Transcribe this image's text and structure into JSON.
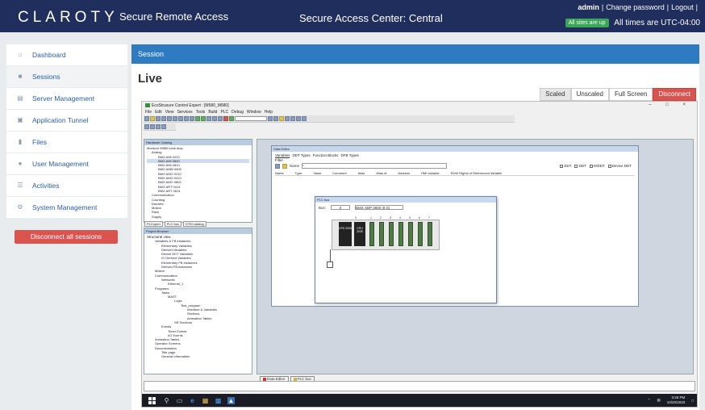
{
  "header": {
    "brand": "CLAROTY",
    "product": "Secure Remote Access",
    "center_name": "Secure Access Center: Central",
    "user": "admin",
    "change_password": "Change password",
    "logout": "Logout",
    "sites_badge": "All sites are up",
    "timezone": "All times are UTC-04:00"
  },
  "sidebar": {
    "items": [
      {
        "label": "Dashboard",
        "icon": "home-icon"
      },
      {
        "label": "Sessions",
        "icon": "video-icon"
      },
      {
        "label": "Server Management",
        "icon": "server-icon"
      },
      {
        "label": "Application Tunnel",
        "icon": "tunnel-icon"
      },
      {
        "label": "Files",
        "icon": "file-icon"
      },
      {
        "label": "User Management",
        "icon": "user-icon"
      },
      {
        "label": "Activities",
        "icon": "list-icon"
      },
      {
        "label": "System Management",
        "icon": "gear-icon"
      }
    ],
    "active_index": 1,
    "disconnect_all": "Disconnect all sessions"
  },
  "main": {
    "section_header": "Session",
    "page_title": "Live",
    "view_buttons": {
      "scaled": "Scaled",
      "unscaled": "Unscaled",
      "full_screen": "Full Screen",
      "disconnect": "Disconnect"
    }
  },
  "remote": {
    "app_title": "EcoStruxure Control Expert : [M580_M580]",
    "menu": [
      "File",
      "Edit",
      "View",
      "Services",
      "Tools",
      "Build",
      "PLC",
      "Debug",
      "Window",
      "Help"
    ],
    "browser_panel": {
      "title": "Hardware Catalog",
      "lines": [
        "Modicon M580 local drop",
        "Analog",
        "BMX AMI 0410",
        "BMX AMI 0800",
        "BMX AMI 0810",
        "BMX AMM 0600",
        "BMX AMO 0210",
        "BMX AMO 0410",
        "BMX AMO 0802",
        "BMX ART 0414",
        "BMX ART 0814",
        "Communication",
        "Counting",
        "Discrete",
        "Motion",
        "Rack",
        "Supply"
      ],
      "tabs": [
        "PLCopen",
        "PLC bus",
        "DTM catalog"
      ]
    },
    "project_panel": {
      "title": "Project Browser",
      "view": "Structural view",
      "lines": [
        "Variables & FB instances",
        "Elementary Variables",
        "Derived Variables",
        "Device DDT Variables",
        "IO Derived Variables",
        "Elementary FB instances",
        "Derived FB instances",
        "Motion",
        "Communication",
        "Networks",
        "Ethernet_1",
        "Programs",
        "Tasks",
        "MAST",
        "Logic",
        "Test_program",
        "Interface & Variables",
        "Sections",
        "Animation Tables",
        "SR Sections",
        "Events",
        "Timer Events",
        "I/O Events",
        "Animation Tables",
        "Operator Screens",
        "Documentation",
        "Title page",
        "General Information"
      ]
    },
    "data_editor": {
      "title": "Data Editor",
      "tabs": [
        "Variables",
        "DDT Types",
        "Function Blocks",
        "DFB Types"
      ],
      "filter": "Filter",
      "name_label": "Name",
      "name_value": "*",
      "checks": [
        "EDT",
        "DDT",
        "IODDT",
        "Device DDT"
      ],
      "columns": [
        "Name",
        "Type",
        "Value",
        "Comment",
        "Alias",
        "Alias of",
        "Address",
        "HMI variable",
        "RUW Rights of Referenced Variable"
      ]
    },
    "plc_bus": {
      "title": "PLC bus",
      "bus_label": "Bus:",
      "bus_number": "0",
      "rack": "BMX XBP 0800 (8 S)",
      "cpu_label": "CPU 2030",
      "cpu_sub": "CPS 2000",
      "slot_labels": [
        "0",
        "1",
        "2",
        "3",
        "4",
        "5",
        "6",
        "7"
      ]
    },
    "bottom_tabs": [
      "Data Editor",
      "PLC bus"
    ],
    "clock": {
      "time": "3:26 PM",
      "date": "10/20/2020"
    }
  }
}
